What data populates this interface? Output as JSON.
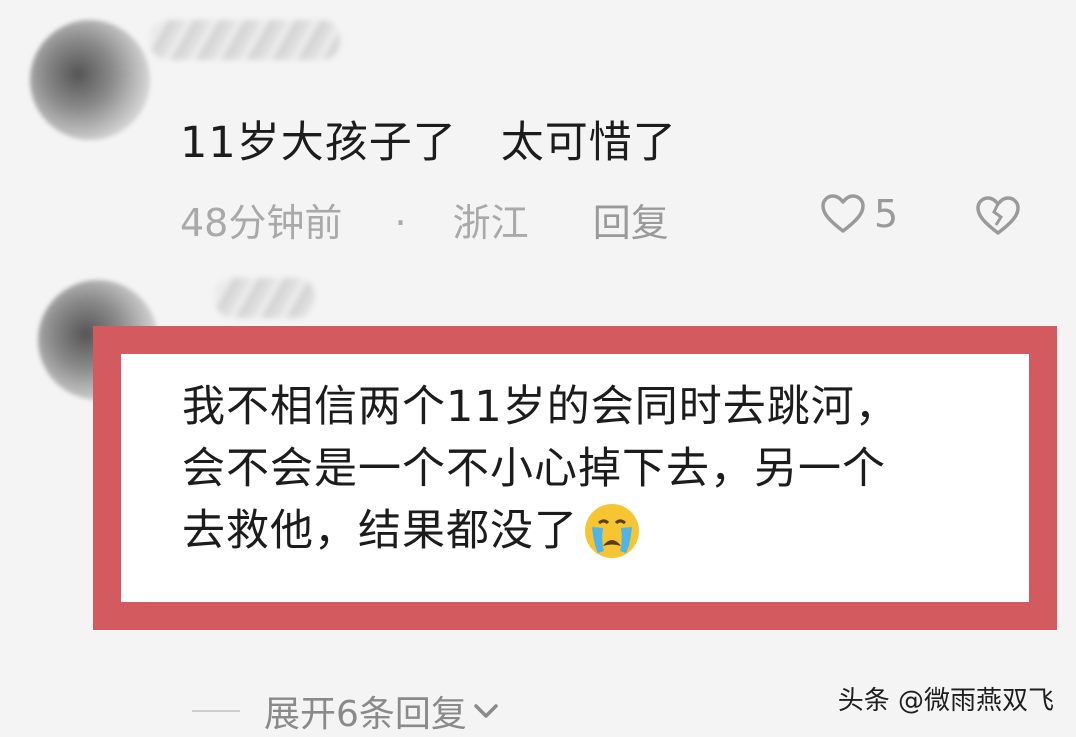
{
  "comments": [
    {
      "text": "11岁大孩子了　太可惜了",
      "time": "48分钟前",
      "separator": "·",
      "location": "浙江",
      "reply_label": "回复",
      "likes": "5"
    },
    {
      "text_lines": [
        "我不相信两个11岁的会同时去跳河，",
        "会不会是一个不小心掉下去，另一个",
        "去救他，结果都没了"
      ],
      "emoji": "loudly-crying-face"
    }
  ],
  "expand_label": "展开6条回复",
  "watermark": "头条 @微雨燕双飞",
  "colors": {
    "highlight_border": "#d35a5e",
    "meta_text": "#a9a9a9",
    "background": "#f4f4f4"
  }
}
